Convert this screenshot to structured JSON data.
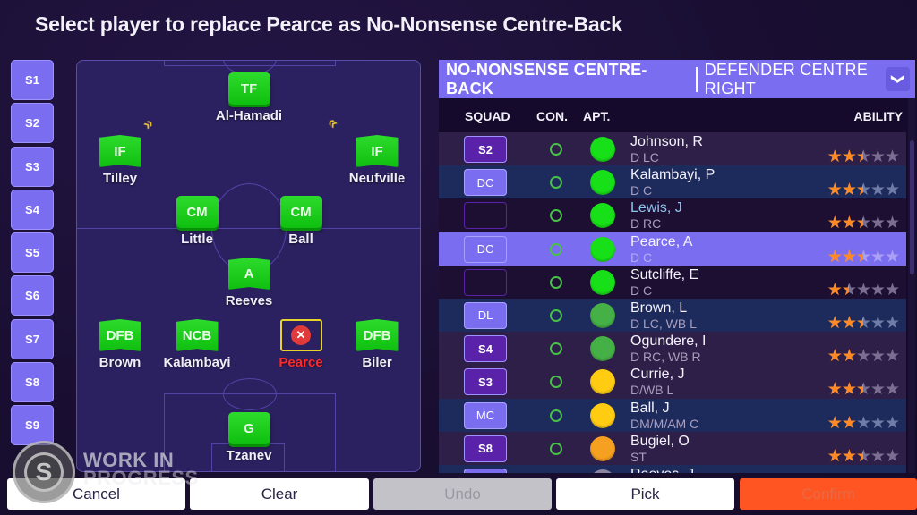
{
  "title": "Select player to replace Pearce as No-Nonsense Centre-Back",
  "subs": [
    "S1",
    "S2",
    "S3",
    "S4",
    "S5",
    "S6",
    "S7",
    "S8",
    "S9"
  ],
  "pitch": {
    "players": [
      {
        "role": "TF",
        "name": "Al-Hamadi",
        "state": "filled"
      },
      {
        "role": "IF",
        "name": "Tilley",
        "state": "filled"
      },
      {
        "role": "IF",
        "name": "Neufville",
        "state": "filled"
      },
      {
        "role": "CM",
        "name": "Little",
        "state": "filled"
      },
      {
        "role": "CM",
        "name": "Ball",
        "state": "filled"
      },
      {
        "role": "A",
        "name": "Reeves",
        "state": "filled"
      },
      {
        "role": "DFB",
        "name": "Brown",
        "state": "filled"
      },
      {
        "role": "NCB",
        "name": "Kalambayi",
        "state": "filled"
      },
      {
        "role": "",
        "name": "Pearce",
        "state": "removed"
      },
      {
        "role": "DFB",
        "name": "Biler",
        "state": "filled"
      },
      {
        "role": "G",
        "name": "Tzanev",
        "state": "filled"
      }
    ],
    "remove_icon": "✕",
    "arrows_icon": "»"
  },
  "panel": {
    "role": "NO-NONSENSE CENTRE-BACK",
    "position": "DEFENDER CENTRE RIGHT",
    "dropdown_icon": "❯",
    "columns": {
      "squad": "SQUAD",
      "con": "CON.",
      "apt": "APT.",
      "ability": "ABILITY"
    },
    "rows": [
      {
        "squad": "S2",
        "squad_type": "sub",
        "name": "Johnson, R",
        "positions": "D LC",
        "apt_color": "#18e018",
        "ability": 2.5,
        "bg": "a"
      },
      {
        "squad": "DC",
        "squad_type": "pos",
        "name": "Kalambayi, P",
        "positions": "D C",
        "apt_color": "#18e018",
        "ability": 2.5,
        "bg": "b"
      },
      {
        "squad": "",
        "squad_type": "none",
        "name": "Lewis, J",
        "positions": "D RC",
        "apt_color": "#18e018",
        "ability": 2.5,
        "bg": "c",
        "name_color": "blue"
      },
      {
        "squad": "DC",
        "squad_type": "selpos",
        "name": "Pearce, A",
        "positions": "D C",
        "apt_color": "#18e018",
        "ability": 2.5,
        "bg": "sel"
      },
      {
        "squad": "",
        "squad_type": "none",
        "name": "Sutcliffe, E",
        "positions": "D C",
        "apt_color": "#18e018",
        "ability": 1.5,
        "bg": "c"
      },
      {
        "squad": "DL",
        "squad_type": "pos",
        "name": "Brown, L",
        "positions": "D LC, WB L",
        "apt_color": "#45b045",
        "ability": 2.5,
        "bg": "b"
      },
      {
        "squad": "S4",
        "squad_type": "sub",
        "name": "Ogundere, I",
        "positions": "D RC, WB R",
        "apt_color": "#45b045",
        "ability": 2,
        "bg": "a"
      },
      {
        "squad": "S3",
        "squad_type": "sub",
        "name": "Currie, J",
        "positions": "D/WB L",
        "apt_color": "#ffcc11",
        "ability": 2.5,
        "bg": "a"
      },
      {
        "squad": "MC",
        "squad_type": "pos",
        "name": "Ball, J",
        "positions": "DM/M/AM C",
        "apt_color": "#ffcc11",
        "ability": 2,
        "bg": "b"
      },
      {
        "squad": "S8",
        "squad_type": "sub",
        "name": "Bugiel, O",
        "positions": "ST",
        "apt_color": "#f5a020",
        "ability": 2.5,
        "bg": "a"
      },
      {
        "squad": "",
        "squad_type": "pos",
        "name": "Reeves, J",
        "positions": "",
        "apt_color": "#8a86a0",
        "ability": 0,
        "bg": "b"
      }
    ],
    "max_stars": 5
  },
  "buttons": {
    "cancel": "Cancel",
    "clear": "Clear",
    "undo": "Undo",
    "pick": "Pick",
    "confirm": "Confirm"
  },
  "watermark": {
    "logo_letter": "S",
    "line1": "WORK IN",
    "line2": "PROGRESS"
  }
}
